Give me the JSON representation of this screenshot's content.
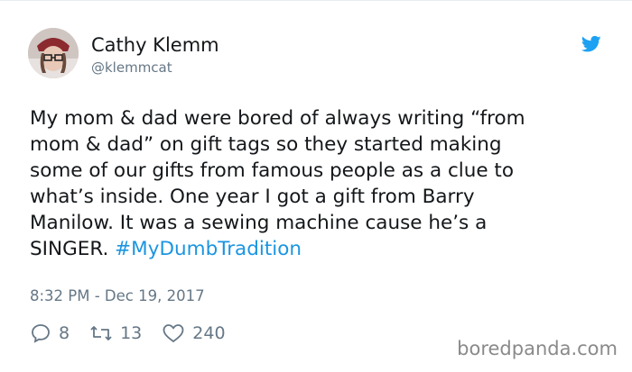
{
  "user": {
    "display_name": "Cathy Klemm",
    "handle": "@klemmcat"
  },
  "tweet": {
    "lines": [
      "My mom & dad were bored of always writing “from",
      "mom & dad” on gift tags so they started making",
      "some of our gifts from famous people as a clue to",
      "what’s inside. One year I got a gift from Barry",
      "Manilow. It was a sewing machine cause he’s a"
    ],
    "last_line_text": "SINGER. ",
    "hashtag": "#MyDumbTradition",
    "timestamp": "8:32 PM - Dec 19, 2017"
  },
  "actions": {
    "replies": "8",
    "retweets": "13",
    "likes": "240"
  },
  "watermark": "boredpanda.com",
  "icons": {
    "brand": "twitter-bird-icon",
    "reply": "reply-icon",
    "retweet": "retweet-icon",
    "like": "heart-icon"
  },
  "colors": {
    "text": "#14171a",
    "secondary": "#657786",
    "link": "#1b95e0",
    "brand": "#1da1f2"
  }
}
